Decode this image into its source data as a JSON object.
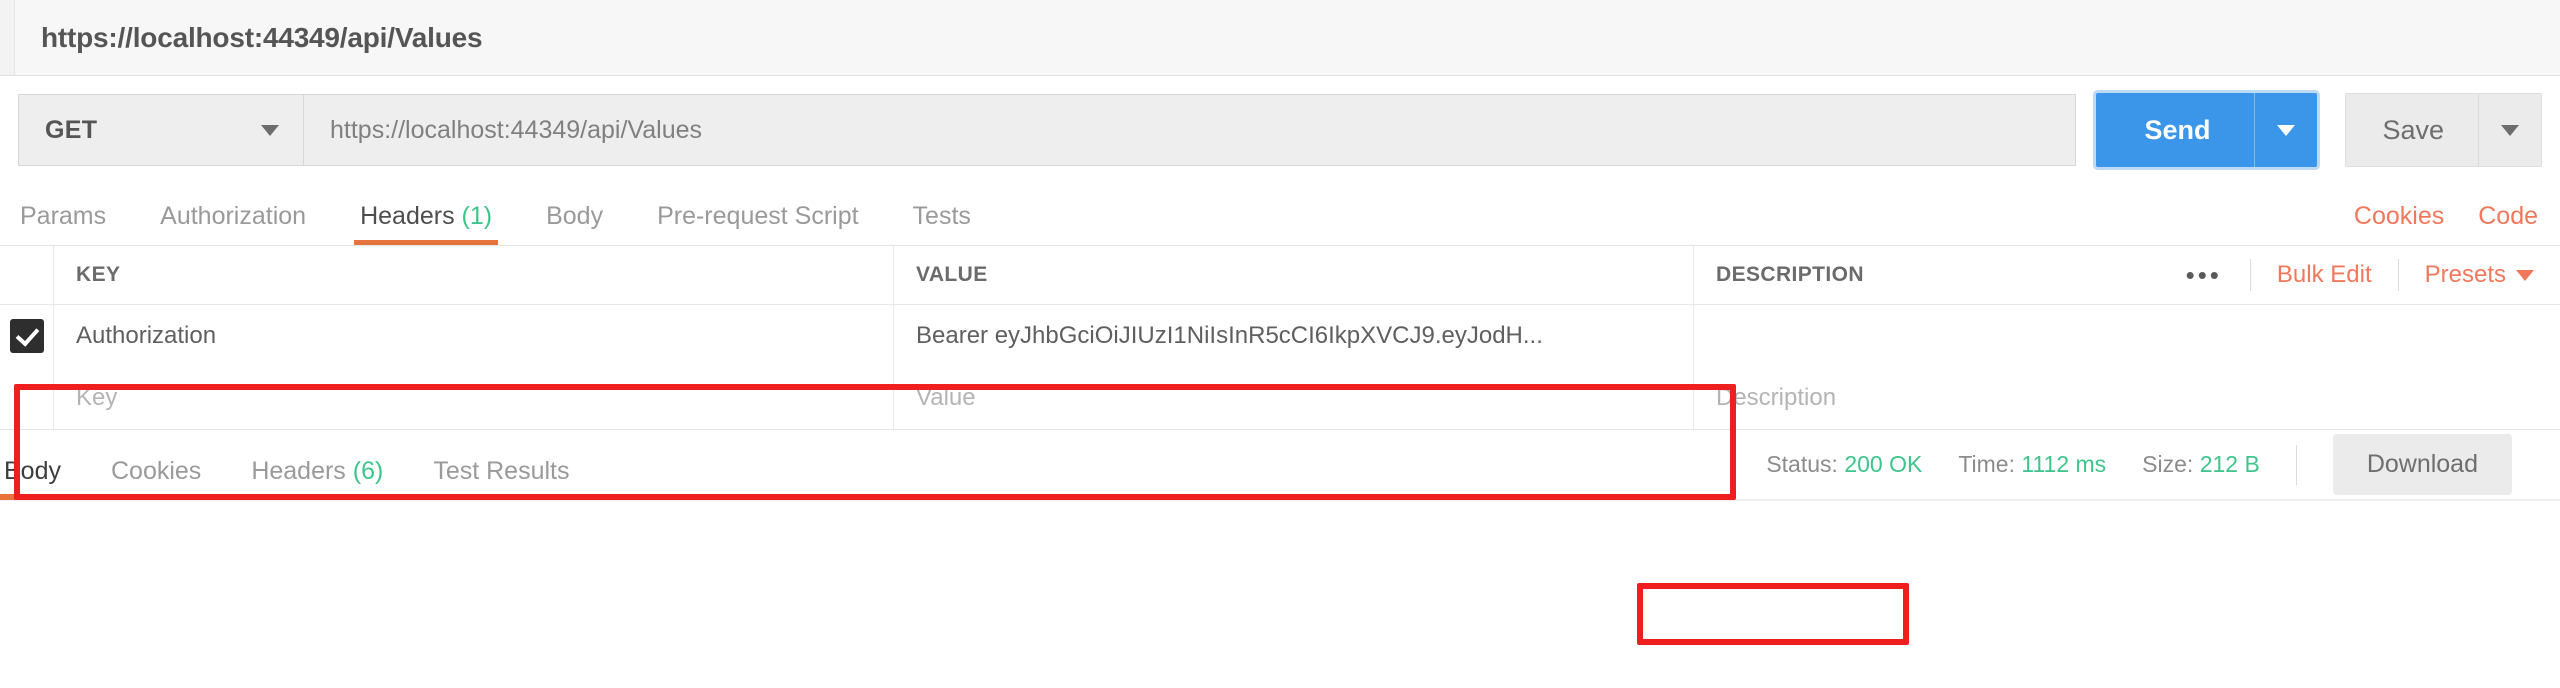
{
  "window": {
    "tab_title": "https://localhost:44349/api/Values"
  },
  "request": {
    "method": "GET",
    "method_caret_icon": "chevron-down-icon",
    "url": "https://localhost:44349/api/Values",
    "send_label": "Send",
    "send_caret_icon": "chevron-down-icon",
    "save_label": "Save",
    "save_caret_icon": "chevron-down-icon",
    "accent_blue": "#3b95e8"
  },
  "request_tabs": {
    "items": [
      {
        "label": "Params",
        "count": "",
        "active": false
      },
      {
        "label": "Authorization",
        "count": "",
        "active": false
      },
      {
        "label": "Headers",
        "count": "(1)",
        "active": true
      },
      {
        "label": "Body",
        "count": "",
        "active": false
      },
      {
        "label": "Pre-request Script",
        "count": "",
        "active": false
      },
      {
        "label": "Tests",
        "count": "",
        "active": false
      }
    ],
    "cookies_link": "Cookies",
    "code_link": "Code",
    "accent_orange": "#e8743b",
    "link_orange": "#f2785c",
    "count_green": "#3ec58b"
  },
  "headers_table": {
    "columns": {
      "key": "KEY",
      "value": "VALUE",
      "description": "DESCRIPTION"
    },
    "actions": {
      "more_icon": "•••",
      "bulk_edit": "Bulk Edit",
      "presets": "Presets",
      "presets_caret_icon": "chevron-down-icon"
    },
    "rows": [
      {
        "checked": true,
        "key": "Authorization",
        "value": "Bearer eyJhbGciOiJIUzI1NiIsInR5cCI6IkpXVCJ9.eyJodH...",
        "description": ""
      }
    ],
    "placeholder_row": {
      "key": "Key",
      "value": "Value",
      "description": "Description"
    }
  },
  "response": {
    "tabs": [
      {
        "label": "Body",
        "count": "",
        "active": true
      },
      {
        "label": "Cookies",
        "count": "",
        "active": false
      },
      {
        "label": "Headers",
        "count": "(6)",
        "active": false
      },
      {
        "label": "Test Results",
        "count": "",
        "active": false
      }
    ],
    "status_label": "Status:",
    "status_value": "200 OK",
    "time_label": "Time:",
    "time_value": "1112 ms",
    "size_label": "Size:",
    "size_value": "212 B",
    "download_label": "Download"
  },
  "annotations": {
    "highlight_color": "#f01f1f",
    "boxes": [
      {
        "name": "authorization-header-row-highlight"
      },
      {
        "name": "status-200-ok-highlight"
      }
    ]
  }
}
